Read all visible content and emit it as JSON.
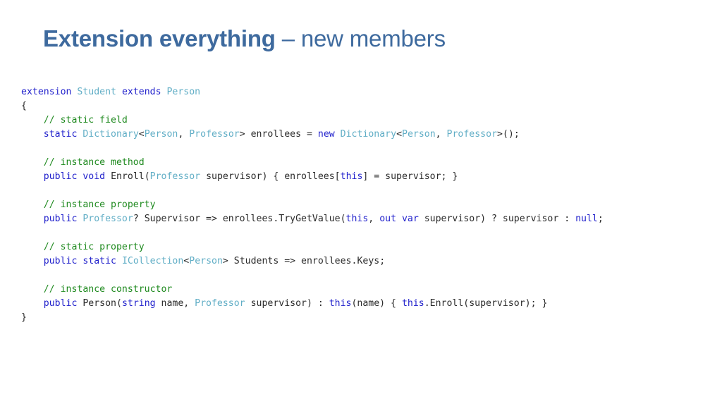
{
  "slide": {
    "background_color": "#ffffff",
    "title": {
      "bold_part": "Extension everything",
      "regular_part": " – new members",
      "color": "#3E6A9E"
    },
    "palette": {
      "keyword": "#2222CC",
      "type": "#61AEC6",
      "comment": "#1F8A1F",
      "plain": "#2b2b2b"
    },
    "code": {
      "language": "csharp",
      "lines": [
        "extension Student extends Person",
        "{",
        "    // static field",
        "    static Dictionary<Person, Professor> enrollees = new Dictionary<Person, Professor>();",
        "",
        "    // instance method",
        "    public void Enroll(Professor supervisor) { enrollees[this] = supervisor; }",
        "",
        "    // instance property",
        "    public Professor? Supervisor => enrollees.TryGetValue(this, out var supervisor) ? supervisor : null;",
        "",
        "    // static property",
        "    public static ICollection<Person> Students => enrollees.Keys;",
        "",
        "    // instance constructor",
        "    public Person(string name, Professor supervisor) : this(name) { this.Enroll(supervisor); }",
        "}"
      ],
      "tokens": {
        "l0": [
          {
            "t": "extension",
            "c": "kw"
          },
          {
            "t": " ",
            "c": "pl"
          },
          {
            "t": "Student",
            "c": "ty"
          },
          {
            "t": " ",
            "c": "pl"
          },
          {
            "t": "extends",
            "c": "kw"
          },
          {
            "t": " ",
            "c": "pl"
          },
          {
            "t": "Person",
            "c": "ty"
          }
        ],
        "l1": [
          {
            "t": "{",
            "c": "pl"
          }
        ],
        "l2": [
          {
            "t": "    ",
            "c": "pl"
          },
          {
            "t": "// static field",
            "c": "cm"
          }
        ],
        "l3": [
          {
            "t": "    ",
            "c": "pl"
          },
          {
            "t": "static",
            "c": "kw"
          },
          {
            "t": " ",
            "c": "pl"
          },
          {
            "t": "Dictionary",
            "c": "ty"
          },
          {
            "t": "<",
            "c": "pl"
          },
          {
            "t": "Person",
            "c": "ty"
          },
          {
            "t": ", ",
            "c": "pl"
          },
          {
            "t": "Professor",
            "c": "ty"
          },
          {
            "t": "> enrollees = ",
            "c": "pl"
          },
          {
            "t": "new",
            "c": "kw"
          },
          {
            "t": " ",
            "c": "pl"
          },
          {
            "t": "Dictionary",
            "c": "ty"
          },
          {
            "t": "<",
            "c": "pl"
          },
          {
            "t": "Person",
            "c": "ty"
          },
          {
            "t": ", ",
            "c": "pl"
          },
          {
            "t": "Professor",
            "c": "ty"
          },
          {
            "t": ">();",
            "c": "pl"
          }
        ],
        "l4": [],
        "l5": [
          {
            "t": "    ",
            "c": "pl"
          },
          {
            "t": "// instance method",
            "c": "cm"
          }
        ],
        "l6": [
          {
            "t": "    ",
            "c": "pl"
          },
          {
            "t": "public",
            "c": "kw"
          },
          {
            "t": " ",
            "c": "pl"
          },
          {
            "t": "void",
            "c": "kw"
          },
          {
            "t": " Enroll(",
            "c": "pl"
          },
          {
            "t": "Professor",
            "c": "ty"
          },
          {
            "t": " supervisor) { enrollees[",
            "c": "pl"
          },
          {
            "t": "this",
            "c": "kw"
          },
          {
            "t": "] = supervisor; }",
            "c": "pl"
          }
        ],
        "l7": [],
        "l8": [
          {
            "t": "    ",
            "c": "pl"
          },
          {
            "t": "// instance property",
            "c": "cm"
          }
        ],
        "l9": [
          {
            "t": "    ",
            "c": "pl"
          },
          {
            "t": "public",
            "c": "kw"
          },
          {
            "t": " ",
            "c": "pl"
          },
          {
            "t": "Professor",
            "c": "ty"
          },
          {
            "t": "? Supervisor => enrollees.TryGetValue(",
            "c": "pl"
          },
          {
            "t": "this",
            "c": "kw"
          },
          {
            "t": ", ",
            "c": "pl"
          },
          {
            "t": "out",
            "c": "kw"
          },
          {
            "t": " ",
            "c": "pl"
          },
          {
            "t": "var",
            "c": "kw"
          },
          {
            "t": " supervisor) ? supervisor : ",
            "c": "pl"
          },
          {
            "t": "null",
            "c": "kw"
          },
          {
            "t": ";",
            "c": "pl"
          }
        ],
        "l10": [],
        "l11": [
          {
            "t": "    ",
            "c": "pl"
          },
          {
            "t": "// static property",
            "c": "cm"
          }
        ],
        "l12": [
          {
            "t": "    ",
            "c": "pl"
          },
          {
            "t": "public",
            "c": "kw"
          },
          {
            "t": " ",
            "c": "pl"
          },
          {
            "t": "static",
            "c": "kw"
          },
          {
            "t": " ",
            "c": "pl"
          },
          {
            "t": "ICollection",
            "c": "ty"
          },
          {
            "t": "<",
            "c": "pl"
          },
          {
            "t": "Person",
            "c": "ty"
          },
          {
            "t": "> Students => enrollees.Keys;",
            "c": "pl"
          }
        ],
        "l13": [],
        "l14": [
          {
            "t": "    ",
            "c": "pl"
          },
          {
            "t": "// instance constructor",
            "c": "cm"
          }
        ],
        "l15": [
          {
            "t": "    ",
            "c": "pl"
          },
          {
            "t": "public",
            "c": "kw"
          },
          {
            "t": " Person(",
            "c": "pl"
          },
          {
            "t": "string",
            "c": "kw"
          },
          {
            "t": " name, ",
            "c": "pl"
          },
          {
            "t": "Professor",
            "c": "ty"
          },
          {
            "t": " supervisor) : ",
            "c": "pl"
          },
          {
            "t": "this",
            "c": "kw"
          },
          {
            "t": "(name) { ",
            "c": "pl"
          },
          {
            "t": "this",
            "c": "kw"
          },
          {
            "t": ".Enroll(supervisor); }",
            "c": "pl"
          }
        ],
        "l16": [
          {
            "t": "}",
            "c": "pl"
          }
        ]
      }
    }
  }
}
